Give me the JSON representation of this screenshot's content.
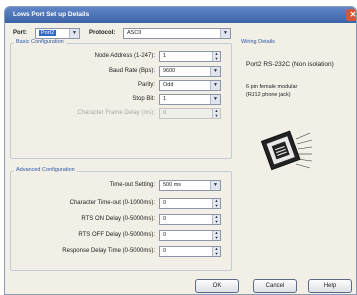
{
  "window": {
    "title": "Lows Port Set up Details"
  },
  "top": {
    "port_label": "Port:",
    "port_value": "Port2",
    "protocol_label": "Protocol:",
    "protocol_value": "ASCII"
  },
  "basic": {
    "title": "Basic Configuration",
    "fields": [
      {
        "label": "Node Address (1-247):",
        "value": "1",
        "kind": "spin"
      },
      {
        "label": "Baud Rate (Bps):",
        "value": "9600",
        "kind": "dropdown"
      },
      {
        "label": "Parity:",
        "value": "Odd",
        "kind": "dropdown"
      },
      {
        "label": "Stop Bit:",
        "value": "1",
        "kind": "dropdown"
      },
      {
        "label": "Character Frame Delay (ms):",
        "value": "0",
        "kind": "spin-disabled"
      }
    ]
  },
  "advanced": {
    "title": "Advanced Configuration",
    "fields": [
      {
        "label": "Time-out Setting:",
        "value": "500 ms",
        "kind": "dropdown"
      },
      {
        "label": "Character Time-out (0-1000ms):",
        "value": "0",
        "kind": "spin"
      },
      {
        "label": "RTS ON Delay (0-5000ms):",
        "value": "0",
        "kind": "spin"
      },
      {
        "label": "RTS OFF Delay (0-5000ms):",
        "value": "0",
        "kind": "spin"
      },
      {
        "label": "Response Delay Time (0-5000ms):",
        "value": "0",
        "kind": "spin"
      }
    ]
  },
  "wiring": {
    "title": "Wiring Details",
    "port_text": "Port2 RS-232C (Non isolation)",
    "desc_line1": "6 pin female modular",
    "desc_line2": "(RJ12 phone jack)"
  },
  "buttons": {
    "ok": "OK",
    "cancel": "Cancel",
    "help": "Help"
  },
  "colors": {
    "title_bar": "#4a72b6",
    "group_title": "#2f5aa8",
    "selection": "#316ac5"
  }
}
